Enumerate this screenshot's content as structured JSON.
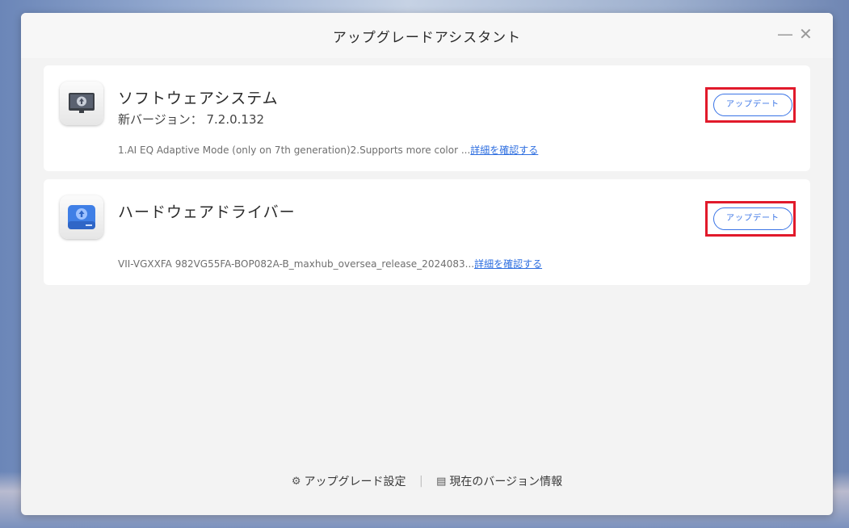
{
  "window": {
    "title": "アップグレードアシスタント",
    "minimize_glyph": "—",
    "close_glyph": "✕"
  },
  "cards": [
    {
      "title": "ソフトウェアシステム",
      "version": "新バージョン：  7.2.0.132",
      "description": "1.AI EQ Adaptive Mode (only on 7th generation)2.Supports more color ...",
      "details_link": "詳細を確認する",
      "button_label": "アップデート",
      "icon": "display-upgrade-icon"
    },
    {
      "title": "ハードウェアドライバー",
      "description": "VII-VGXXFA 982VG55FA-BOP082A-B_maxhub_oversea_release_2024083...",
      "details_link": "詳細を確認する",
      "button_label": "アップデート",
      "icon": "hard-drive-upgrade-icon"
    }
  ],
  "footer": {
    "settings_icon": "⚙",
    "settings_label": "アップグレード設定",
    "separator": "|",
    "version_icon": "▤",
    "version_label": "現在のバージョン情報"
  },
  "colors": {
    "accent": "#3a74e6",
    "highlight": "#e11a2b"
  }
}
